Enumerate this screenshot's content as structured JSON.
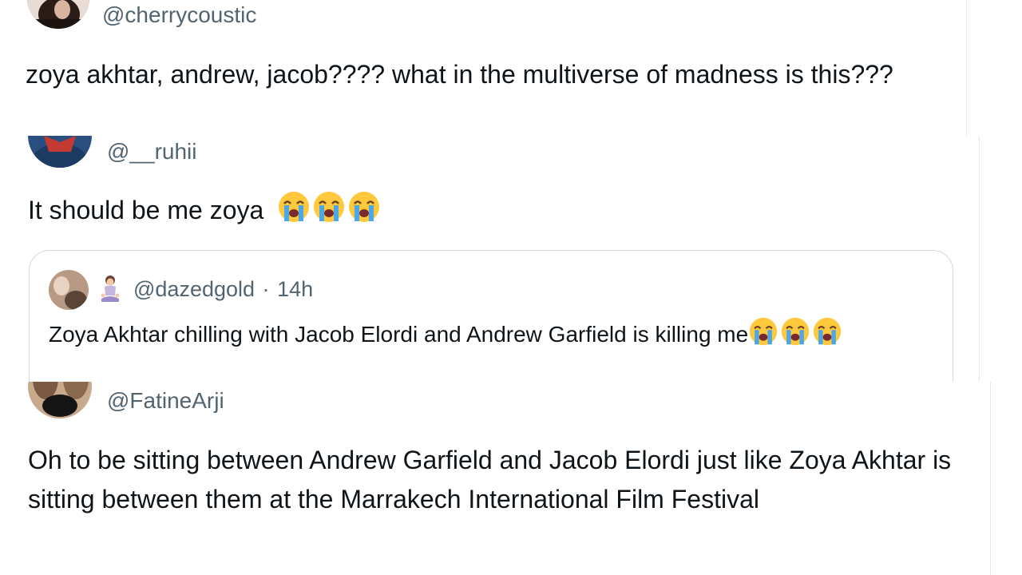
{
  "tweets": [
    {
      "handle": "@cherrycoustic",
      "text": "zoya akhtar, andrew, jacob???? what in the multiverse of madness is this???"
    },
    {
      "handle": "@__ruhii",
      "text": "It should be me zoya",
      "emoji": [
        "loudly-crying-face",
        "loudly-crying-face",
        "loudly-crying-face"
      ],
      "quoted": {
        "handle": "@dazedgold",
        "separator": "·",
        "time": "14h",
        "badge_icon": "meditating-woman-emoji",
        "text": "Zoya Akhtar chilling with Jacob Elordi and Andrew Garfield is killing me",
        "emoji": [
          "loudly-crying-face",
          "loudly-crying-face",
          "loudly-crying-face"
        ]
      }
    },
    {
      "handle": "@FatineArji",
      "text": "Oh to be sitting between Andrew Garfield and Jacob Elordi just like Zoya Akhtar is sitting between them at the Marrakech International Film Festival"
    }
  ],
  "colors": {
    "text": "#0f1419",
    "secondary": "#536471",
    "border": "#cfd9de",
    "emoji_face": "#ffc83d",
    "emoji_tears": "#4aa8e8"
  }
}
